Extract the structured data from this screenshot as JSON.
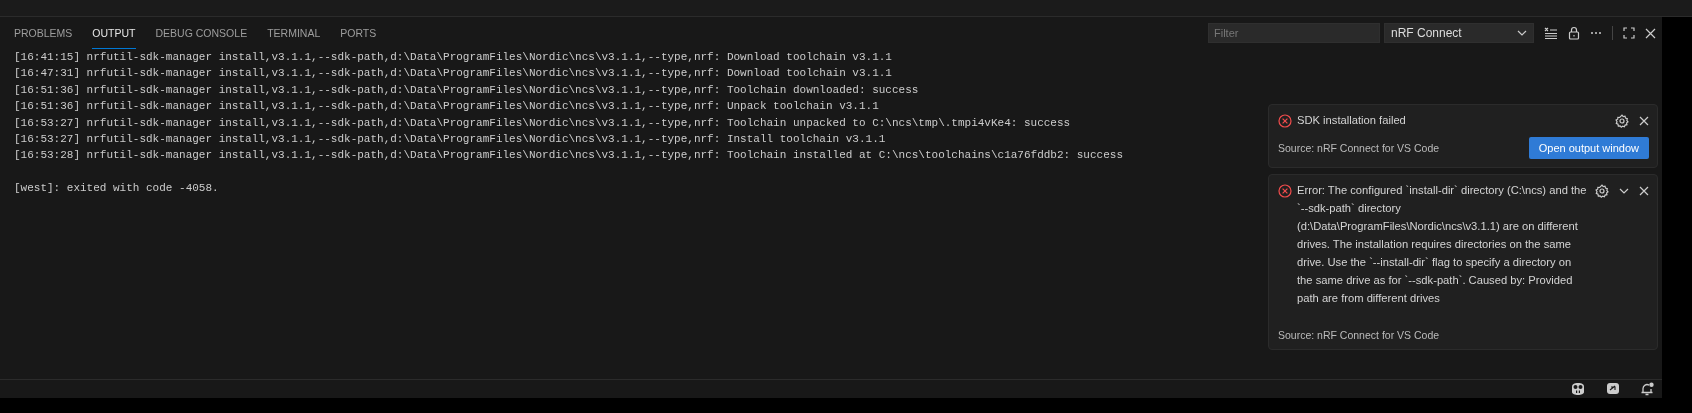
{
  "panel_tabs": [
    {
      "label": "PROBLEMS",
      "selected": false
    },
    {
      "label": "OUTPUT",
      "selected": true
    },
    {
      "label": "DEBUG CONSOLE",
      "selected": false
    },
    {
      "label": "TERMINAL",
      "selected": false
    },
    {
      "label": "PORTS",
      "selected": false
    }
  ],
  "filter": {
    "placeholder": "Filter"
  },
  "channel_select": {
    "value": "nRF Connect"
  },
  "output_blocks": [
    [
      "[16:41:15] nrfutil-sdk-manager install,v3.1.1,--sdk-path,d:\\Data\\ProgramFiles\\Nordic\\ncs\\v3.1.1,--type,nrf: Download toolchain v3.1.1",
      "[16:47:31] nrfutil-sdk-manager install,v3.1.1,--sdk-path,d:\\Data\\ProgramFiles\\Nordic\\ncs\\v3.1.1,--type,nrf: Download toolchain v3.1.1",
      "[16:51:36] nrfutil-sdk-manager install,v3.1.1,--sdk-path,d:\\Data\\ProgramFiles\\Nordic\\ncs\\v3.1.1,--type,nrf: Toolchain downloaded: success",
      "[16:51:36] nrfutil-sdk-manager install,v3.1.1,--sdk-path,d:\\Data\\ProgramFiles\\Nordic\\ncs\\v3.1.1,--type,nrf: Unpack toolchain v3.1.1",
      "[16:53:27] nrfutil-sdk-manager install,v3.1.1,--sdk-path,d:\\Data\\ProgramFiles\\Nordic\\ncs\\v3.1.1,--type,nrf: Toolchain unpacked to C:\\ncs\\tmp\\.tmpi4vKe4: success",
      "[16:53:27] nrfutil-sdk-manager install,v3.1.1,--sdk-path,d:\\Data\\ProgramFiles\\Nordic\\ncs\\v3.1.1,--type,nrf: Install toolchain v3.1.1",
      "[16:53:28] nrfutil-sdk-manager install,v3.1.1,--sdk-path,d:\\Data\\ProgramFiles\\Nordic\\ncs\\v3.1.1,--type,nrf: Toolchain installed at C:\\ncs\\toolchains\\c1a76fddb2: success"
    ],
    [
      "[west]: exited with code -4058."
    ]
  ],
  "notifications": [
    {
      "kind": "error",
      "message": "SDK installation failed",
      "source": "Source: nRF Connect for VS Code",
      "button": "Open output window",
      "collapsible": false
    },
    {
      "kind": "error",
      "message": "Error: The configured `install-dir` directory (C:\\ncs) and the `--sdk-path` directory (d:\\Data\\ProgramFiles\\Nordic\\ncs\\v3.1.1) are on different drives. The installation requires directories on the same drive. Use the `--install-dir` flag to specify a directory on the same drive as for `--sdk-path`. Caused by: Provided path are from different drives",
      "source": "Source: nRF Connect for VS Code",
      "collapsible": true
    }
  ]
}
